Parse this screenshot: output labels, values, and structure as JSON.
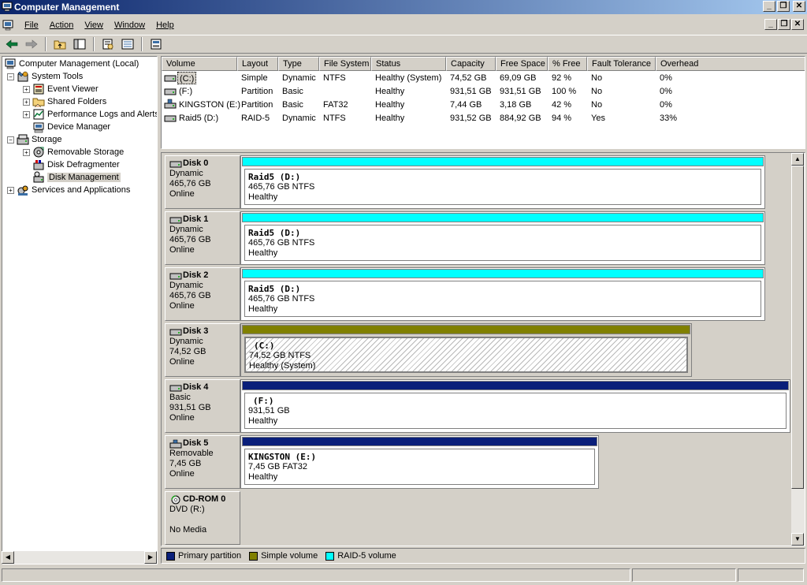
{
  "window": {
    "title": "Computer Management",
    "controls": [
      "minimize-icon",
      "restore-icon",
      "close-icon"
    ]
  },
  "menu": {
    "items": [
      {
        "label": "File"
      },
      {
        "label": "Action"
      },
      {
        "label": "View"
      },
      {
        "label": "Window"
      },
      {
        "label": "Help"
      }
    ]
  },
  "toolbar": {
    "icons": [
      "back-arrow-icon",
      "forward-arrow-icon",
      "up-folder-icon",
      "show-hide-tree-icon",
      "properties-icon",
      "export-list-icon",
      "help-icon"
    ]
  },
  "tree": {
    "root": "Computer Management (Local)",
    "items": [
      {
        "label": "System Tools",
        "icon": "system-tools-icon",
        "expander": "−"
      },
      {
        "label": "Event Viewer",
        "icon": "event-viewer-icon",
        "expander": "+"
      },
      {
        "label": "Shared Folders",
        "icon": "shared-folders-icon",
        "expander": "+"
      },
      {
        "label": "Performance Logs and Alerts",
        "icon": "performance-icon",
        "expander": "+"
      },
      {
        "label": "Device Manager",
        "icon": "device-manager-icon",
        "expander": ""
      },
      {
        "label": "Storage",
        "icon": "storage-icon",
        "expander": "−"
      },
      {
        "label": "Removable Storage",
        "icon": "removable-storage-icon",
        "expander": "+"
      },
      {
        "label": "Disk Defragmenter",
        "icon": "defragmenter-icon",
        "expander": ""
      },
      {
        "label": "Disk Management",
        "icon": "disk-management-icon",
        "expander": ""
      },
      {
        "label": "Services and Applications",
        "icon": "services-icon",
        "expander": "+"
      }
    ]
  },
  "volumes": {
    "columns": [
      "Volume",
      "Layout",
      "Type",
      "File System",
      "Status",
      "Capacity",
      "Free Space",
      "% Free",
      "Fault Tolerance",
      "Overhead"
    ],
    "rows": [
      {
        "volume": "(C:)",
        "layout": "Simple",
        "type": "Dynamic",
        "fs": "NTFS",
        "status": "Healthy (System)",
        "capacity": "74,52 GB",
        "free": "69,09 GB",
        "pct": "92 %",
        "fault": "No",
        "overhead": "0%"
      },
      {
        "volume": "(F:)",
        "layout": "Partition",
        "type": "Basic",
        "fs": "",
        "status": "Healthy",
        "capacity": "931,51 GB",
        "free": "931,51 GB",
        "pct": "100 %",
        "fault": "No",
        "overhead": "0%"
      },
      {
        "volume": "KINGSTON (E:)",
        "layout": "Partition",
        "type": "Basic",
        "fs": "FAT32",
        "status": "Healthy",
        "capacity": "7,44 GB",
        "free": "3,18 GB",
        "pct": "42 %",
        "fault": "No",
        "overhead": "0%"
      },
      {
        "volume": "Raid5 (D:)",
        "layout": "RAID-5",
        "type": "Dynamic",
        "fs": "NTFS",
        "status": "Healthy",
        "capacity": "931,52 GB",
        "free": "884,92 GB",
        "pct": "94 %",
        "fault": "Yes",
        "overhead": "33%"
      }
    ]
  },
  "disks": [
    {
      "name": "Disk 0",
      "type": "Dynamic",
      "size": "465,76 GB",
      "state": "Online",
      "partition": {
        "name": "Raid5  (D:)",
        "detail": "465,76 GB NTFS",
        "status": "Healthy",
        "kind": "raid5"
      }
    },
    {
      "name": "Disk 1",
      "type": "Dynamic",
      "size": "465,76 GB",
      "state": "Online",
      "partition": {
        "name": "Raid5  (D:)",
        "detail": "465,76 GB NTFS",
        "status": "Healthy",
        "kind": "raid5"
      }
    },
    {
      "name": "Disk 2",
      "type": "Dynamic",
      "size": "465,76 GB",
      "state": "Online",
      "partition": {
        "name": "Raid5  (D:)",
        "detail": "465,76 GB NTFS",
        "status": "Healthy",
        "kind": "raid5"
      }
    },
    {
      "name": "Disk 3",
      "type": "Dynamic",
      "size": "74,52 GB",
      "state": "Online",
      "partition": {
        "name": "(C:)",
        "detail": "74,52 GB NTFS",
        "status": "Healthy (System)",
        "kind": "simple"
      }
    },
    {
      "name": "Disk 4",
      "type": "Basic",
      "size": "931,51 GB",
      "state": "Online",
      "partition": {
        "name": "(F:)",
        "detail": "931,51 GB",
        "status": "Healthy",
        "kind": "primary"
      }
    },
    {
      "name": "Disk 5",
      "type": "Removable",
      "size": "7,45 GB",
      "state": "Online",
      "partition": {
        "name": "KINGSTON  (E:)",
        "detail": "7,45 GB FAT32",
        "status": "Healthy",
        "kind": "primary"
      }
    },
    {
      "name": "CD-ROM 0",
      "type": "DVD (R:)",
      "size": "",
      "state": "No Media"
    }
  ],
  "legend": [
    {
      "label": "Primary partition",
      "color": "#0a1f7a"
    },
    {
      "label": "Simple volume",
      "color": "#808000"
    },
    {
      "label": "RAID-5 volume",
      "color": "#00ffff"
    }
  ],
  "colors": {
    "raid5": "#00ffff",
    "simple": "#808000",
    "primary": "#0a1f7a"
  }
}
